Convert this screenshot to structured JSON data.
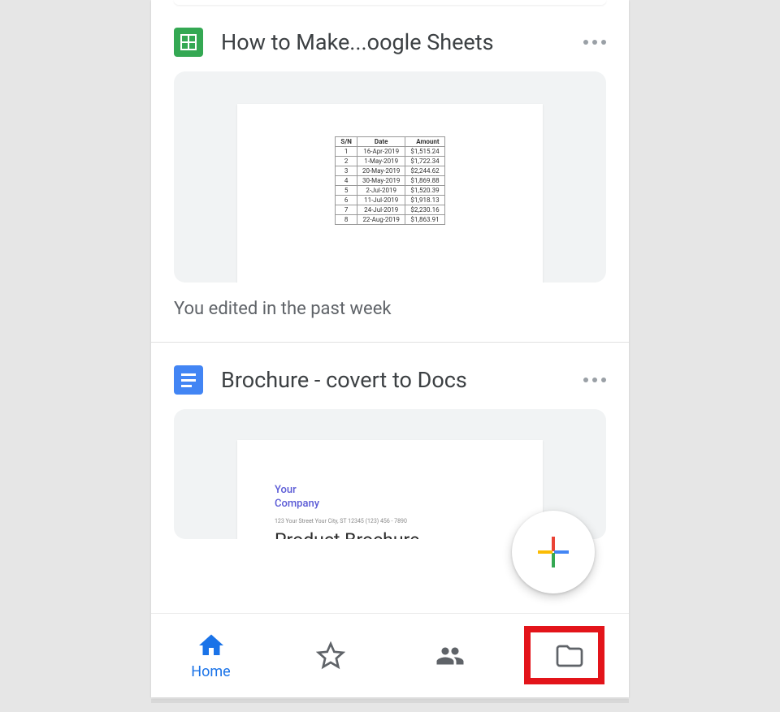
{
  "files": [
    {
      "type": "sheets",
      "title": "How to Make...oogle Sheets",
      "meta": "You edited in the past week",
      "table": {
        "headers": [
          "S/N",
          "Date",
          "Amount"
        ],
        "rows": [
          [
            "1",
            "16-Apr-2019",
            "$1,515.24"
          ],
          [
            "2",
            "1-May-2019",
            "$1,722.34"
          ],
          [
            "3",
            "20-May-2019",
            "$2,244.62"
          ],
          [
            "4",
            "30-May-2019",
            "$1,869.88"
          ],
          [
            "5",
            "2-Jul-2019",
            "$1,520.39"
          ],
          [
            "6",
            "11-Jul-2019",
            "$1,918.13"
          ],
          [
            "7",
            "24-Jul-2019",
            "$2,230.16"
          ],
          [
            "8",
            "22-Aug-2019",
            "$1,863.91"
          ]
        ]
      }
    },
    {
      "type": "docs",
      "title": "Brochure - covert to Docs",
      "brochure": {
        "company_line1": "Your",
        "company_line2": "Company",
        "address": "123 Your Street Your City, ST 12345 (123) 456 - 7890",
        "heading": "Product Brochure"
      }
    }
  ],
  "nav": {
    "home": "Home"
  }
}
